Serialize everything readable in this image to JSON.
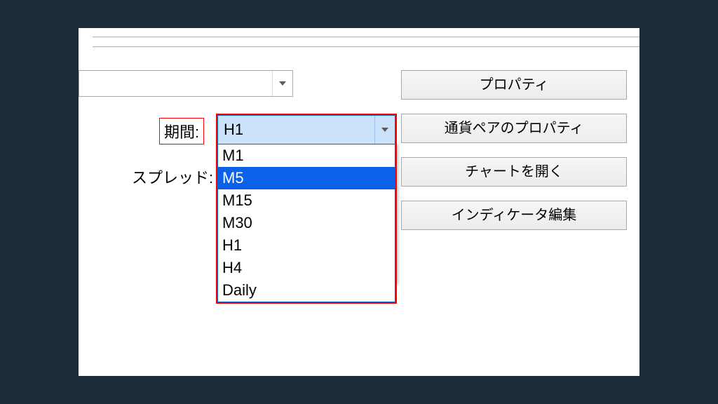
{
  "labels": {
    "period": "期間:",
    "spread": "スプレッド:"
  },
  "buttons": {
    "properties": "プロパティ",
    "symbol_properties": "通貨ペアのプロパティ",
    "open_chart": "チャートを開く",
    "edit_indicator": "インディケータ編集"
  },
  "combo_top": {
    "value": ""
  },
  "period_select": {
    "value": "H1",
    "highlighted": "M5",
    "options": [
      "M1",
      "M5",
      "M15",
      "M30",
      "H1",
      "H4",
      "Daily"
    ]
  }
}
